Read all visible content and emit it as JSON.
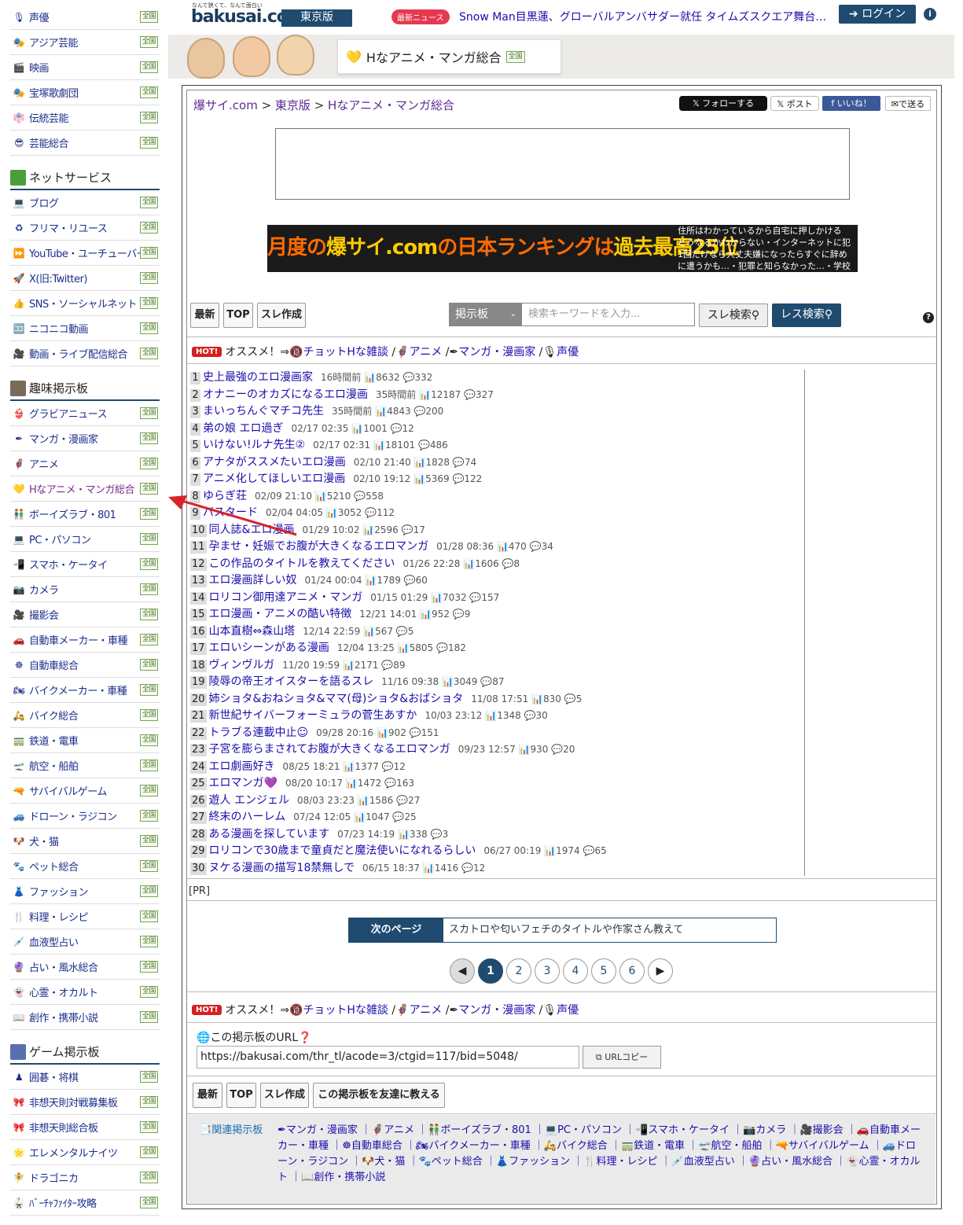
{
  "sidebar": {
    "zen_label": "全国",
    "group1": [
      {
        "icon": "🎙",
        "label": "声優"
      },
      {
        "icon": "🎭",
        "label": "アジア芸能"
      },
      {
        "icon": "🎬",
        "label": "映画"
      },
      {
        "icon": "🎭",
        "label": "宝塚歌劇団"
      },
      {
        "icon": "👘",
        "label": "伝統芸能"
      },
      {
        "icon": "😎",
        "label": "芸能総合"
      }
    ],
    "head_net": "ネットサービス",
    "group2": [
      {
        "icon": "💻",
        "label": "ブログ"
      },
      {
        "icon": "♻",
        "label": "フリマ・リユース"
      },
      {
        "icon": "⏩",
        "label": "YouTube・ユーチューバー"
      },
      {
        "icon": "🚀",
        "label": "X(旧:Twitter)"
      },
      {
        "icon": "👍",
        "label": "SNS・ソーシャルネット"
      },
      {
        "icon": "🈁",
        "label": "ニコニコ動画"
      },
      {
        "icon": "🎥",
        "label": "動画・ライブ配信総合"
      }
    ],
    "head_hobby": "趣味掲示板",
    "group3": [
      {
        "icon": "👙",
        "label": "グラビアニュース"
      },
      {
        "icon": "✒",
        "label": "マンガ・漫画家"
      },
      {
        "icon": "🦸",
        "label": "アニメ"
      },
      {
        "icon": "💛",
        "label": "Hなアニメ・マンガ総合",
        "active": true
      },
      {
        "icon": "👬",
        "label": "ボーイズラブ・801"
      },
      {
        "icon": "💻",
        "label": "PC・パソコン"
      },
      {
        "icon": "📲",
        "label": "スマホ・ケータイ"
      },
      {
        "icon": "📷",
        "label": "カメラ"
      },
      {
        "icon": "🎥",
        "label": "撮影会"
      },
      {
        "icon": "🚗",
        "label": "自動車メーカー・車種"
      },
      {
        "icon": "☸",
        "label": "自動車総合"
      },
      {
        "icon": "🏍",
        "label": "バイクメーカー・車種"
      },
      {
        "icon": "🛵",
        "label": "バイク総合"
      },
      {
        "icon": "🚃",
        "label": "鉄道・電車"
      },
      {
        "icon": "🛫",
        "label": "航空・船舶"
      },
      {
        "icon": "🔫",
        "label": "サバイバルゲーム"
      },
      {
        "icon": "🚙",
        "label": "ドローン・ラジコン"
      },
      {
        "icon": "🐶",
        "label": "犬・猫"
      },
      {
        "icon": "🐾",
        "label": "ペット総合"
      },
      {
        "icon": "👗",
        "label": "ファッション"
      },
      {
        "icon": "🍴",
        "label": "料理・レシピ"
      },
      {
        "icon": "💉",
        "label": "血液型占い"
      },
      {
        "icon": "🔮",
        "label": "占い・風水総合"
      },
      {
        "icon": "👻",
        "label": "心霊・オカルト"
      },
      {
        "icon": "📖",
        "label": "創作・携帯小説"
      }
    ],
    "head_game": "ゲーム掲示板",
    "group4": [
      {
        "icon": "♟",
        "label": "囲碁・将棋"
      },
      {
        "icon": "🎀",
        "label": "非想天則対戦募集板"
      },
      {
        "icon": "🎀",
        "label": "非想天則総合板"
      },
      {
        "icon": "🌟",
        "label": "エレメンタルナイツ"
      },
      {
        "icon": "🧚",
        "label": "ドラゴニカ"
      },
      {
        "icon": "🥋",
        "label": "ﾊﾞｰﾁｬﾌｧｲﾀｰ攻略"
      }
    ]
  },
  "header": {
    "tagline": "なんて狭くて、なんて面白い",
    "logo": "bakusai.com",
    "region": "東京版",
    "news_badge": "最新ニュース",
    "news_text": "Snow Man目黒蓮、グローバルアンバサダー就任 タイムズスクエア舞台…",
    "login": "ログイン",
    "category_title": "Hなアニメ・マンガ総合"
  },
  "breadcrumb": {
    "home": "爆サイ.com",
    "region": "東京版",
    "current": "Hなアニメ・マンガ総合"
  },
  "social": {
    "follow": "フォローする",
    "post": "ポスト",
    "like": "いいね！",
    "send": "で送る"
  },
  "ad2": {
    "big_a": "月度の",
    "big_b": "爆サイ.com",
    "big_c": "の日本ランキングは",
    "big_d": "過去最高25位",
    "side_lines": [
      "住所はわかっているから自宅に押しかける",
      "どうなるかわからない・インターネットに犯",
      "1回だけなら大丈夫嫌になったらすぐに辞め",
      "に遭うかも…・犯罪と知らなかった…・学校"
    ]
  },
  "buttons": {
    "latest": "最新",
    "top": "TOP",
    "create": "スレ作成",
    "share": "この掲示板を友達に教える"
  },
  "search": {
    "select": "掲示板",
    "placeholder": "検索キーワードを入力...",
    "thread_search": "スレ検索",
    "res_search": "レス検索"
  },
  "recommend": {
    "hot": "HOT!",
    "lead": "オススメ！⇒",
    "links": [
      "チョットHな雑談",
      "アニメ",
      "マンガ・漫画家",
      "声優"
    ]
  },
  "threads": [
    {
      "n": "1",
      "title": "史上最強のエロ漫画家",
      "time": "16時間前",
      "views": "8632",
      "res": "332"
    },
    {
      "n": "2",
      "title": "オナニーのオカズになるエロ漫画",
      "time": "35時間前",
      "views": "12187",
      "res": "327"
    },
    {
      "n": "3",
      "title": "まいっちんぐマチコ先生",
      "time": "35時間前",
      "views": "4843",
      "res": "200"
    },
    {
      "n": "4",
      "title": "弟の娘 エロ過ぎ",
      "time": "02/17 02:35",
      "views": "1001",
      "res": "12"
    },
    {
      "n": "5",
      "title": "いけない!ルナ先生②",
      "time": "02/17 02:31",
      "views": "18101",
      "res": "486"
    },
    {
      "n": "6",
      "title": "アナタがススメたいエロ漫画",
      "time": "02/10 21:40",
      "views": "1828",
      "res": "74"
    },
    {
      "n": "7",
      "title": "アニメ化してほしいエロ漫画",
      "time": "02/10 19:12",
      "views": "5369",
      "res": "122"
    },
    {
      "n": "8",
      "title": "ゆらぎ荘",
      "time": "02/09 21:10",
      "views": "5210",
      "res": "558"
    },
    {
      "n": "9",
      "title": "バスタード",
      "time": "02/04 04:05",
      "views": "3052",
      "res": "112"
    },
    {
      "n": "10",
      "title": "同人誌&エロ漫画",
      "time": "01/29 10:02",
      "views": "2596",
      "res": "17"
    },
    {
      "n": "11",
      "title": "孕ませ・妊娠でお腹が大きくなるエロマンガ",
      "time": "01/28 08:36",
      "views": "470",
      "res": "34"
    },
    {
      "n": "12",
      "title": "この作品のタイトルを教えてください",
      "time": "01/26 22:28",
      "views": "1606",
      "res": "8"
    },
    {
      "n": "13",
      "title": "エロ漫画詳しい奴",
      "time": "01/24 00:04",
      "views": "1789",
      "res": "60"
    },
    {
      "n": "14",
      "title": "ロリコン御用達アニメ・マンガ",
      "time": "01/15 01:29",
      "views": "7032",
      "res": "157"
    },
    {
      "n": "15",
      "title": "エロ漫画・アニメの酷い特徴",
      "time": "12/21 14:01",
      "views": "952",
      "res": "9"
    },
    {
      "n": "16",
      "title": "山本直樹⇔森山塔",
      "time": "12/14 22:59",
      "views": "567",
      "res": "5"
    },
    {
      "n": "17",
      "title": "エロいシーンがある漫画",
      "time": "12/04 13:25",
      "views": "5805",
      "res": "182"
    },
    {
      "n": "18",
      "title": "ヴィンヴルガ",
      "time": "11/20 19:59",
      "views": "2171",
      "res": "89"
    },
    {
      "n": "19",
      "title": "陵辱の帝王オイスターを語るスレ",
      "time": "11/16 09:38",
      "views": "3049",
      "res": "87"
    },
    {
      "n": "20",
      "title": "姉ショタ&おねショタ&ママ(母)ショタ&おばショタ",
      "time": "11/08 17:51",
      "views": "830",
      "res": "5"
    },
    {
      "n": "21",
      "title": "新世紀サイバーフォーミュラの菅生あすか",
      "time": "10/03 23:12",
      "views": "1348",
      "res": "30"
    },
    {
      "n": "22",
      "title": "トラブる連載中止☺",
      "time": "09/28 20:16",
      "views": "902",
      "res": "151"
    },
    {
      "n": "23",
      "title": "子宮を膨らまされてお腹が大きくなるエロマンガ",
      "time": "09/23 12:57",
      "views": "930",
      "res": "20"
    },
    {
      "n": "24",
      "title": "エロ劇画好き",
      "time": "08/25 18:21",
      "views": "1377",
      "res": "12"
    },
    {
      "n": "25",
      "title": "エロマンガ💜",
      "time": "08/20 10:17",
      "views": "1472",
      "res": "163"
    },
    {
      "n": "26",
      "title": "遊人 エンジェル",
      "time": "08/03 23:23",
      "views": "1586",
      "res": "27"
    },
    {
      "n": "27",
      "title": "終末のハーレム",
      "time": "07/24 12:05",
      "views": "1047",
      "res": "25"
    },
    {
      "n": "28",
      "title": "ある漫画を探しています",
      "time": "07/23 14:19",
      "views": "338",
      "res": "3"
    },
    {
      "n": "29",
      "title": "ロリコンで30歳まで童貞だと魔法使いになれるらしい",
      "time": "06/27 00:19",
      "views": "1974",
      "res": "65"
    },
    {
      "n": "30",
      "title": "ヌケる漫画の描写18禁無しで",
      "time": "06/15 18:37",
      "views": "1416",
      "res": "12"
    }
  ],
  "pr": "[PR]",
  "next_page": {
    "label": "次のページ",
    "title": "スカトロや匂いフェチのタイトルや作家さん教えて"
  },
  "pagination": [
    "1",
    "2",
    "3",
    "4",
    "5",
    "6"
  ],
  "url_section": {
    "label": "この掲示板のURL",
    "url": "https://bakusai.com/thr_tl/acode=3/ctgid=117/bid=5048/",
    "copy": "URLコピー"
  },
  "related": {
    "label": "関連掲示板",
    "links": [
      "マンガ・漫画家",
      "アニメ",
      "ボーイズラブ・801",
      "PC・パソコン",
      "スマホ・ケータイ",
      "カメラ",
      "撮影会",
      "自動車メーカー・車種",
      "自動車総合",
      "バイクメーカー・車種",
      "バイク総合",
      "鉄道・電車",
      "航空・船舶",
      "サバイバルゲーム",
      "ドローン・ラジコン",
      "犬・猫",
      "ペット総合",
      "ファッション",
      "料理・レシピ",
      "血液型占い",
      "占い・風水総合",
      "心霊・オカルト",
      "創作・携帯小説"
    ]
  },
  "colors": {
    "navy": "#1f4b70",
    "link": "#1a0dab",
    "hot": "#d42020",
    "arrow": "#d8232a"
  }
}
